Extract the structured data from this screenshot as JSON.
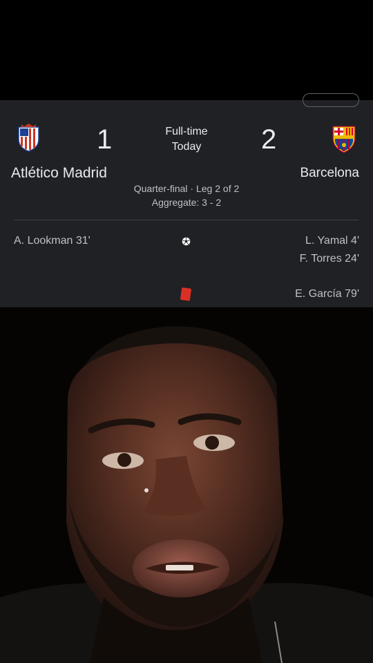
{
  "match": {
    "home_team": "Atlético Madrid",
    "away_team": "Barcelona",
    "home_score": "1",
    "away_score": "2",
    "status": "Full-time",
    "date": "Today",
    "round": "Quarter-final · Leg 2 of 2",
    "aggregate": "Aggregate: 3 - 2"
  },
  "events": {
    "home_goals": [
      "A. Lookman 31'"
    ],
    "away_goals": [
      "L. Yamal 4'",
      "F. Torres 24'"
    ],
    "away_red_cards": [
      "E. García 79'"
    ]
  },
  "icons": {
    "goal": "soccer-ball-icon",
    "red_card": "red-card-icon",
    "home_crest": "atletico-madrid-crest-icon",
    "away_crest": "barcelona-crest-icon"
  },
  "colors": {
    "card_bg": "#202124",
    "text_primary": "#e8eaed",
    "text_secondary": "#bdc1c6",
    "red_card": "#d93025"
  }
}
